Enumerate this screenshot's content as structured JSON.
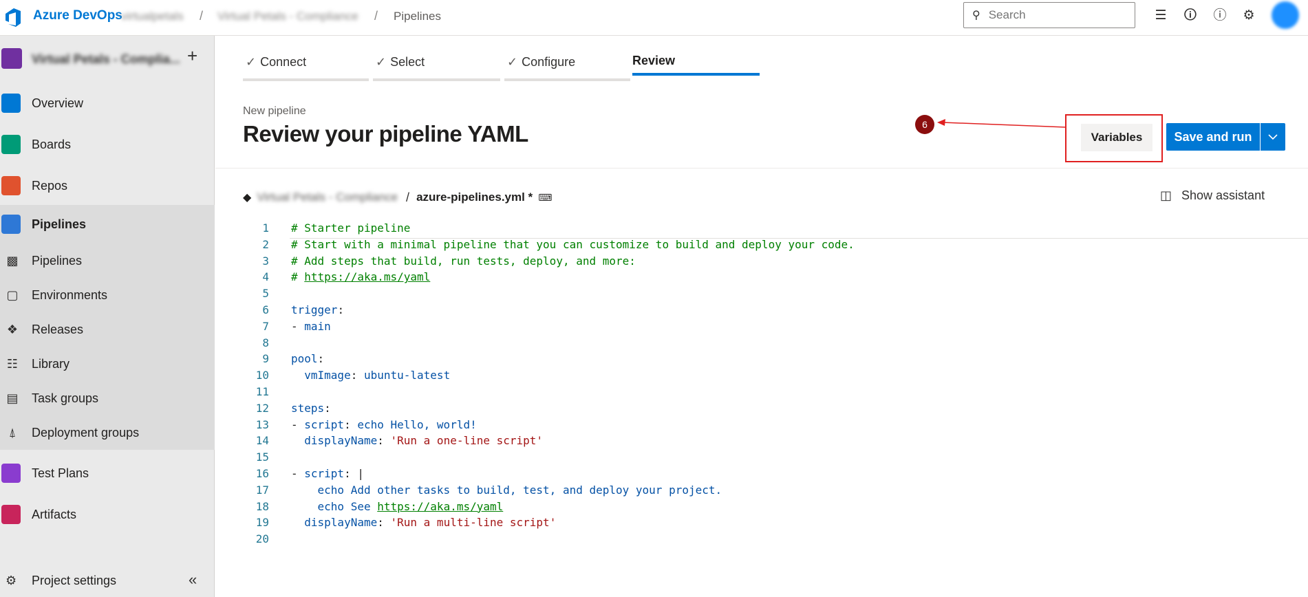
{
  "topbar": {
    "brand": "Azure DevOps",
    "org": "virtualpetals",
    "project": "Virtual Petals - Compliance",
    "page": "Pipelines",
    "separator": "/",
    "search_placeholder": "Search",
    "icons": [
      "search-icon",
      "task-list-icon",
      "shopping-bag-icon",
      "help-icon",
      "user-settings-icon"
    ]
  },
  "sidebar": {
    "project_name": "Virtual Petals - Complia...",
    "add_label": "+",
    "items": [
      {
        "label": "Overview",
        "icon": "overview-icon",
        "color": "#0078d4"
      },
      {
        "label": "Boards",
        "icon": "boards-icon",
        "color": "#009b77"
      },
      {
        "label": "Repos",
        "icon": "repos-icon",
        "color": "#e0522e"
      },
      {
        "label": "Pipelines",
        "icon": "pipelines-icon",
        "color": "#2e78d6"
      }
    ],
    "sub_items": [
      {
        "label": "Pipelines",
        "icon": "pipelines-sub-icon"
      },
      {
        "label": "Environments",
        "icon": "environments-icon"
      },
      {
        "label": "Releases",
        "icon": "releases-icon"
      },
      {
        "label": "Library",
        "icon": "library-icon"
      },
      {
        "label": "Task groups",
        "icon": "task-groups-icon"
      },
      {
        "label": "Deployment groups",
        "icon": "deployment-groups-icon"
      }
    ],
    "items_after": [
      {
        "label": "Test Plans",
        "icon": "test-plans-icon",
        "color": "#8a3ccf"
      },
      {
        "label": "Artifacts",
        "icon": "artifacts-icon",
        "color": "#c8245b"
      }
    ],
    "settings_label": "Project settings"
  },
  "wizard": {
    "tabs": [
      {
        "label": "Connect",
        "done": true
      },
      {
        "label": "Select",
        "done": true
      },
      {
        "label": "Configure",
        "done": true
      },
      {
        "label": "Review",
        "done": false,
        "active": true
      }
    ],
    "check": "✓"
  },
  "header": {
    "subtitle": "New pipeline",
    "title": "Review your pipeline YAML",
    "annotation_number": "6",
    "variables_label": "Variables",
    "save_run_label": "Save and run"
  },
  "file": {
    "repo_name": "Virtual Petals - Compliance",
    "separator": "/",
    "file_name": "azure-pipelines.yml *",
    "show_assistant_label": "Show assistant"
  },
  "editor": {
    "lines": [
      {
        "n": "1",
        "parts": [
          [
            "c-comment",
            "# Starter pipeline"
          ]
        ]
      },
      {
        "n": "2",
        "parts": [
          [
            "c-comment",
            "# Start with a minimal pipeline that you can customize to build and deploy your code."
          ]
        ]
      },
      {
        "n": "3",
        "parts": [
          [
            "c-comment",
            "# Add steps that build, run tests, deploy, and more:"
          ]
        ]
      },
      {
        "n": "4",
        "parts": [
          [
            "c-comment",
            "# "
          ],
          [
            "c-url",
            "https://aka.ms/yaml"
          ]
        ]
      },
      {
        "n": "5",
        "parts": []
      },
      {
        "n": "6",
        "parts": [
          [
            "c-key",
            "trigger"
          ],
          [
            "c-plain",
            ":"
          ]
        ]
      },
      {
        "n": "7",
        "parts": [
          [
            "c-plain",
            "- "
          ],
          [
            "c-text",
            "main"
          ]
        ]
      },
      {
        "n": "8",
        "parts": []
      },
      {
        "n": "9",
        "parts": [
          [
            "c-key",
            "pool"
          ],
          [
            "c-plain",
            ":"
          ]
        ]
      },
      {
        "n": "10",
        "parts": [
          [
            "c-plain",
            "  "
          ],
          [
            "c-key",
            "vmImage"
          ],
          [
            "c-plain",
            ": "
          ],
          [
            "c-text",
            "ubuntu-latest"
          ]
        ]
      },
      {
        "n": "11",
        "parts": []
      },
      {
        "n": "12",
        "parts": [
          [
            "c-key",
            "steps"
          ],
          [
            "c-plain",
            ":"
          ]
        ]
      },
      {
        "n": "13",
        "parts": [
          [
            "c-plain",
            "- "
          ],
          [
            "c-key",
            "script"
          ],
          [
            "c-plain",
            ": "
          ],
          [
            "c-text",
            "echo Hello, world!"
          ]
        ]
      },
      {
        "n": "14",
        "parts": [
          [
            "c-plain",
            "  "
          ],
          [
            "c-key",
            "displayName"
          ],
          [
            "c-plain",
            ": "
          ],
          [
            "c-str",
            "'Run a one-line script'"
          ]
        ]
      },
      {
        "n": "15",
        "parts": []
      },
      {
        "n": "16",
        "parts": [
          [
            "c-plain",
            "- "
          ],
          [
            "c-key",
            "script"
          ],
          [
            "c-plain",
            ": "
          ],
          [
            "c-plain",
            "|"
          ]
        ]
      },
      {
        "n": "17",
        "parts": [
          [
            "c-plain",
            "    "
          ],
          [
            "c-text",
            "echo Add other tasks to build, test, and deploy your project."
          ]
        ]
      },
      {
        "n": "18",
        "parts": [
          [
            "c-plain",
            "    "
          ],
          [
            "c-text",
            "echo See "
          ],
          [
            "c-url",
            "https://aka.ms/yaml"
          ]
        ]
      },
      {
        "n": "19",
        "parts": [
          [
            "c-plain",
            "  "
          ],
          [
            "c-key",
            "displayName"
          ],
          [
            "c-plain",
            ": "
          ],
          [
            "c-str",
            "'Run a multi-line script'"
          ]
        ]
      },
      {
        "n": "20",
        "parts": []
      }
    ]
  },
  "colors": {
    "accent": "#0078d4",
    "annotation": "#e02020"
  }
}
